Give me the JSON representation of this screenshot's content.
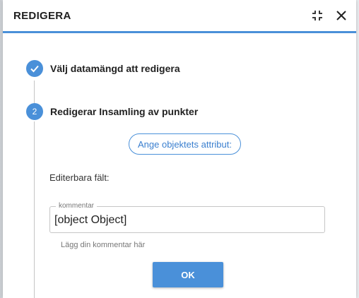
{
  "header": {
    "title": "REDIGERA",
    "collapse_icon": "collapse-icon",
    "close_icon": "close-icon"
  },
  "steps": [
    {
      "index": "✓",
      "label": "Välj datamängd att redigera",
      "state": "done"
    },
    {
      "index": "2",
      "label": "Redigerar Insamling av punkter",
      "state": "active"
    }
  ],
  "attributes_button": {
    "label": "Ange objektets attribut:"
  },
  "editable_fields_label": "Editerbara fält:",
  "comment_field": {
    "legend": "kommentar",
    "value": "[object Object]",
    "hint": "Lägg din kommentar här"
  },
  "ok_button": {
    "label": "OK"
  },
  "colors": {
    "accent": "#4a90d9",
    "text": "#222222",
    "muted": "#777777"
  }
}
